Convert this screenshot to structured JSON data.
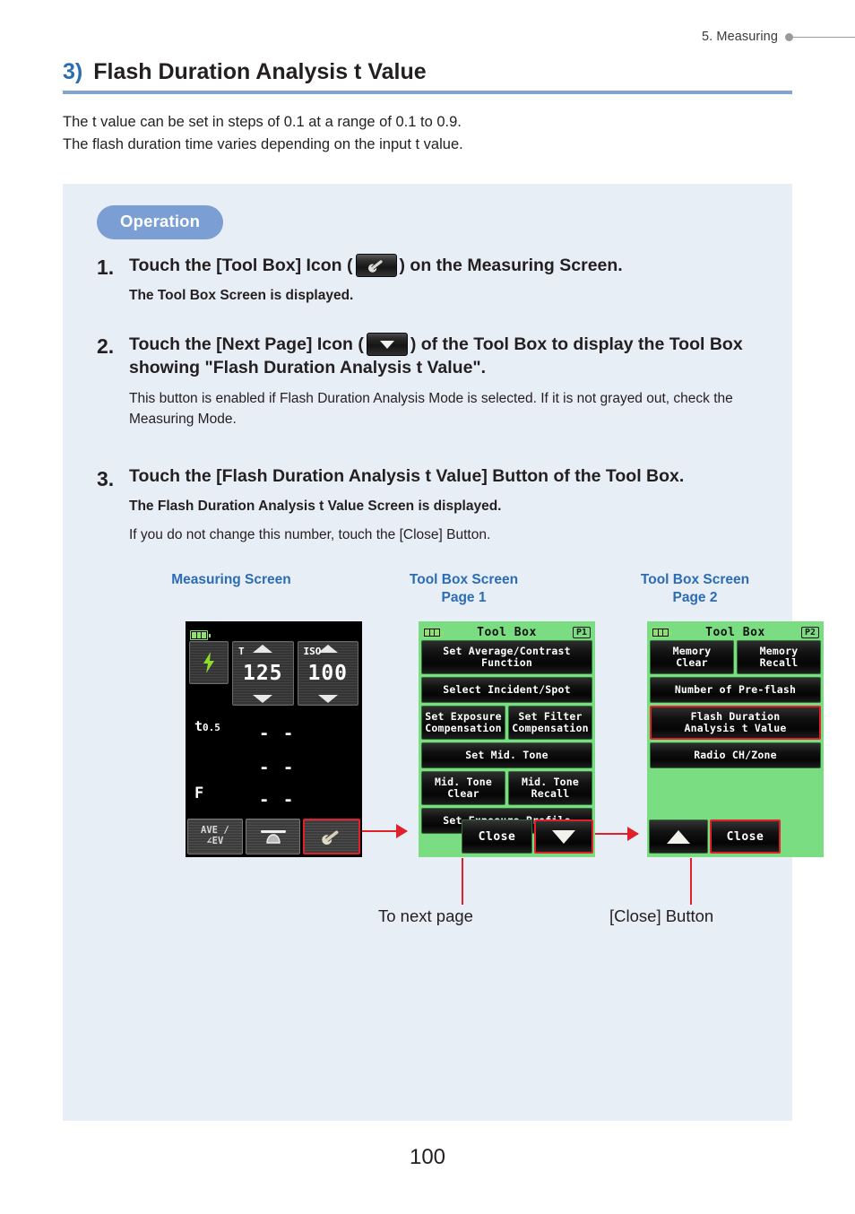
{
  "header": {
    "chapter": "5.  Measuring"
  },
  "title": {
    "number": "3)",
    "text": "Flash Duration Analysis t Value"
  },
  "intro": {
    "line1": "The t value can be set in steps of 0.1 at a range of 0.1 to 0.9.",
    "line2": "The flash duration time varies depending on the input t value."
  },
  "operation": {
    "badge": "Operation",
    "steps": [
      {
        "num": "1.",
        "head_before": "Touch the [Tool Box] Icon (",
        "head_after": ") on the Measuring Screen.",
        "icon": "wrench-icon",
        "sub_bold": "The Tool Box Screen is displayed."
      },
      {
        "num": "2.",
        "head_before": "Touch the [Next Page] Icon (",
        "head_after": ") of the Tool Box to display the Tool Box showing \"Flash Duration Analysis t Value\".",
        "icon": "triangle-down-icon",
        "sub": "This button is enabled if Flash Duration Analysis Mode is selected. If it is not grayed out, check the Measuring Mode."
      },
      {
        "num": "3.",
        "head": "Touch the [Flash Duration Analysis t Value] Button of the Tool Box.",
        "sub_bold": "The Flash Duration Analysis t Value Screen is displayed.",
        "sub": "If you do not change this number, touch the [Close] Button."
      }
    ]
  },
  "figure": {
    "captions": {
      "measuring": "Measuring Screen",
      "page1_line1": "Tool Box Screen",
      "page1_line2": "Page 1",
      "page2_line1": "Tool Box Screen",
      "page2_line2": "Page 2"
    },
    "measuring_screen": {
      "battery_icon": "battery-icon",
      "flash_icon": "flash-bolt-icon",
      "shutter_label": "T",
      "shutter_value": "125",
      "iso_label": "ISO",
      "iso_value": "100",
      "t_label": "t",
      "t_value": "0.5",
      "f_label": "F",
      "dash_1": "- -",
      "dash_2": "- -",
      "dash_3": "- -",
      "btn_ave_line1": "AVE /",
      "btn_ave_line2": "∠EV",
      "btn_dome_icon": "dome-sensor-icon",
      "btn_toolbox_icon": "wrench-icon"
    },
    "toolbox_page1": {
      "title": "Tool Box",
      "page_tag": "P1",
      "buttons": [
        "Set Average/Contrast\nFunction",
        "Select Incident/Spot",
        "Set Exposure\nCompensation",
        "Set Filter\nCompensation",
        "Set Mid. Tone",
        "Mid. Tone\nClear",
        "Mid. Tone\nRecall",
        "Set Exposure Profile"
      ],
      "close_label": "Close",
      "next_page_icon": "triangle-down-icon"
    },
    "toolbox_page2": {
      "title": "Tool Box",
      "page_tag": "P2",
      "buttons": [
        "Memory\nClear",
        "Memory\nRecall",
        "Number of Pre-flash",
        "Flash Duration\nAnalysis t Value",
        "Radio CH/Zone"
      ],
      "prev_page_icon": "triangle-up-icon",
      "close_label": "Close"
    },
    "annotations": {
      "to_next_page": "To next page",
      "close_button": "[Close] Button"
    }
  },
  "page_number": "100",
  "colors": {
    "accent_blue": "#2b6cb5",
    "rule_blue": "#7fa4d4",
    "panel_bg": "#e8eef6",
    "badge_bg": "#7b9fd4",
    "highlight_red": "#e0202a",
    "screen_green": "#7bdd82"
  }
}
